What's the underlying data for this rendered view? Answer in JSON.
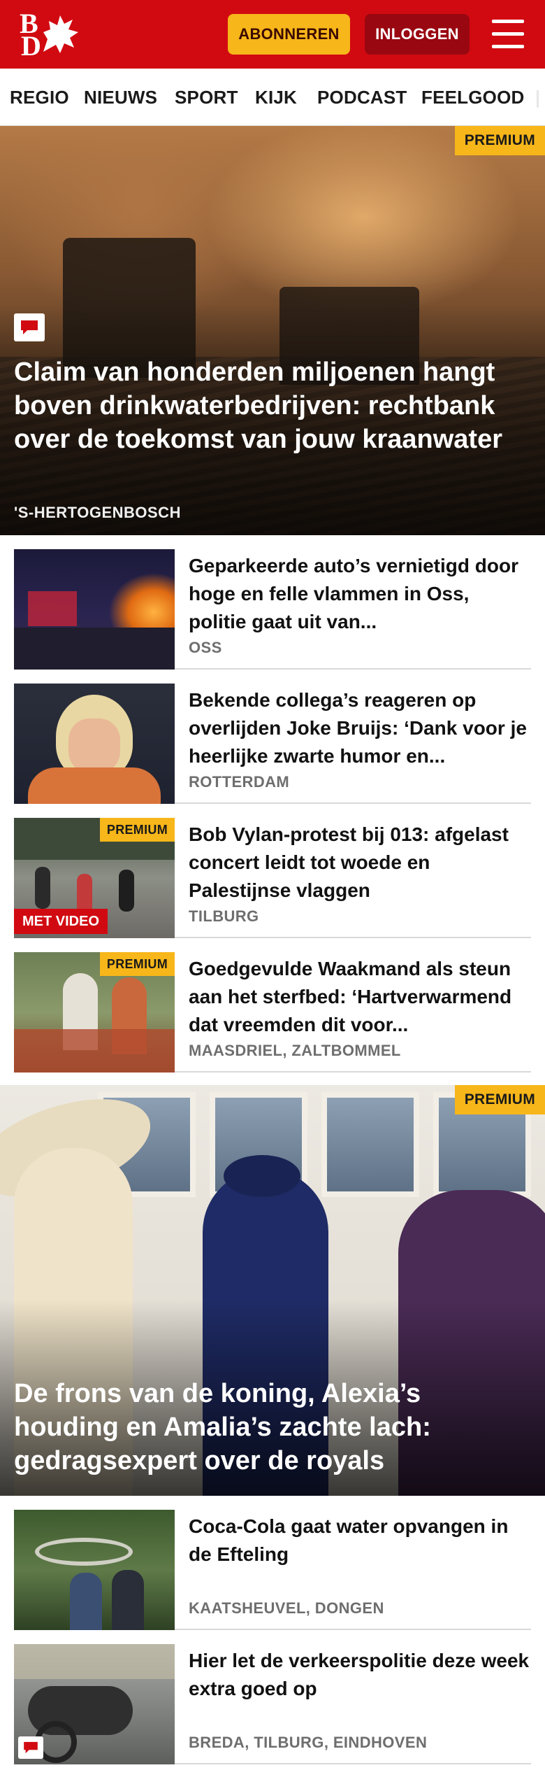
{
  "header": {
    "logo_text": "BD",
    "subscribe_label": "ABONNEREN",
    "login_label": "INLOGGEN"
  },
  "nav": {
    "items": [
      "REGIO",
      "NIEUWS",
      "SPORT",
      "KIJK",
      "PODCAST",
      "FEELGOOD"
    ]
  },
  "badges": {
    "premium": "PREMIUM",
    "video": "MET VIDEO"
  },
  "lead_story": {
    "title": "Claim van honderden miljoenen hangt boven drinkwaterbedrijven: rechtbank over de toekomst van jouw kraanwater",
    "place": "'S-HERTOGENBOSCH"
  },
  "articles_1": [
    {
      "title": "Geparkeerde auto’s vernietigd door hoge en felle vlammen in Oss, politie gaat uit van...",
      "place": "OSS"
    },
    {
      "title": "Bekende collega’s reageren op overlijden Joke Bruijs: ‘Dank voor je heerlijke zwarte humor en...",
      "place": "ROTTERDAM"
    },
    {
      "title": "Bob Vylan-protest bij 013: afgelast concert leidt tot woede en Palestijnse vlaggen",
      "place": "TILBURG"
    },
    {
      "title": "Goedgevulde Waakmand als steun aan het sterfbed: ‘Hartver­warmend dat vreemden dit voor...",
      "place": "MAASDRIEL, ZALTBOMMEL"
    }
  ],
  "second_lead": {
    "title": "De frons van de koning, Alexia’s houding en Amalia’s zachte lach: gedragsexpert over de royals"
  },
  "articles_2": [
    {
      "title": "Coca-Cola gaat water opvangen in de Efteling",
      "place": "KAATSHEUVEL, DONGEN"
    },
    {
      "title": "Hier let de verkeerspolitie deze week extra goed op",
      "place": "BREDA, TILBURG, EINDHOVEN"
    }
  ],
  "colors": {
    "brand_red": "#d10a11",
    "subscribe_yellow": "#f7b619",
    "login_dark_red": "#990711"
  }
}
